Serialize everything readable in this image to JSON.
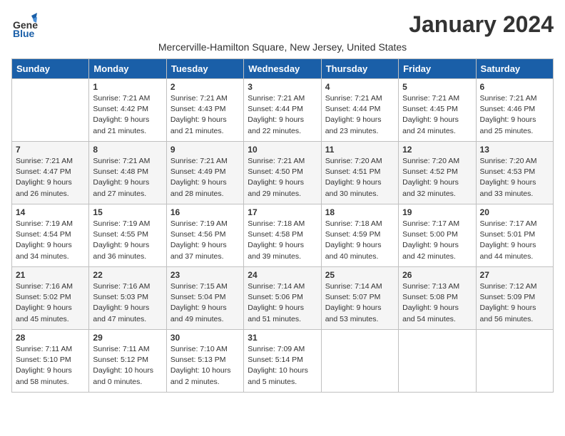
{
  "header": {
    "logo_general": "General",
    "logo_blue": "Blue",
    "month_title": "January 2024",
    "location": "Mercerville-Hamilton Square, New Jersey, United States"
  },
  "weekdays": [
    "Sunday",
    "Monday",
    "Tuesday",
    "Wednesday",
    "Thursday",
    "Friday",
    "Saturday"
  ],
  "weeks": [
    [
      {
        "day": "",
        "sunrise": "",
        "sunset": "",
        "daylight": ""
      },
      {
        "day": "1",
        "sunrise": "Sunrise: 7:21 AM",
        "sunset": "Sunset: 4:42 PM",
        "daylight": "Daylight: 9 hours and 21 minutes."
      },
      {
        "day": "2",
        "sunrise": "Sunrise: 7:21 AM",
        "sunset": "Sunset: 4:43 PM",
        "daylight": "Daylight: 9 hours and 21 minutes."
      },
      {
        "day": "3",
        "sunrise": "Sunrise: 7:21 AM",
        "sunset": "Sunset: 4:44 PM",
        "daylight": "Daylight: 9 hours and 22 minutes."
      },
      {
        "day": "4",
        "sunrise": "Sunrise: 7:21 AM",
        "sunset": "Sunset: 4:44 PM",
        "daylight": "Daylight: 9 hours and 23 minutes."
      },
      {
        "day": "5",
        "sunrise": "Sunrise: 7:21 AM",
        "sunset": "Sunset: 4:45 PM",
        "daylight": "Daylight: 9 hours and 24 minutes."
      },
      {
        "day": "6",
        "sunrise": "Sunrise: 7:21 AM",
        "sunset": "Sunset: 4:46 PM",
        "daylight": "Daylight: 9 hours and 25 minutes."
      }
    ],
    [
      {
        "day": "7",
        "sunrise": "Sunrise: 7:21 AM",
        "sunset": "Sunset: 4:47 PM",
        "daylight": "Daylight: 9 hours and 26 minutes."
      },
      {
        "day": "8",
        "sunrise": "Sunrise: 7:21 AM",
        "sunset": "Sunset: 4:48 PM",
        "daylight": "Daylight: 9 hours and 27 minutes."
      },
      {
        "day": "9",
        "sunrise": "Sunrise: 7:21 AM",
        "sunset": "Sunset: 4:49 PM",
        "daylight": "Daylight: 9 hours and 28 minutes."
      },
      {
        "day": "10",
        "sunrise": "Sunrise: 7:21 AM",
        "sunset": "Sunset: 4:50 PM",
        "daylight": "Daylight: 9 hours and 29 minutes."
      },
      {
        "day": "11",
        "sunrise": "Sunrise: 7:20 AM",
        "sunset": "Sunset: 4:51 PM",
        "daylight": "Daylight: 9 hours and 30 minutes."
      },
      {
        "day": "12",
        "sunrise": "Sunrise: 7:20 AM",
        "sunset": "Sunset: 4:52 PM",
        "daylight": "Daylight: 9 hours and 32 minutes."
      },
      {
        "day": "13",
        "sunrise": "Sunrise: 7:20 AM",
        "sunset": "Sunset: 4:53 PM",
        "daylight": "Daylight: 9 hours and 33 minutes."
      }
    ],
    [
      {
        "day": "14",
        "sunrise": "Sunrise: 7:19 AM",
        "sunset": "Sunset: 4:54 PM",
        "daylight": "Daylight: 9 hours and 34 minutes."
      },
      {
        "day": "15",
        "sunrise": "Sunrise: 7:19 AM",
        "sunset": "Sunset: 4:55 PM",
        "daylight": "Daylight: 9 hours and 36 minutes."
      },
      {
        "day": "16",
        "sunrise": "Sunrise: 7:19 AM",
        "sunset": "Sunset: 4:56 PM",
        "daylight": "Daylight: 9 hours and 37 minutes."
      },
      {
        "day": "17",
        "sunrise": "Sunrise: 7:18 AM",
        "sunset": "Sunset: 4:58 PM",
        "daylight": "Daylight: 9 hours and 39 minutes."
      },
      {
        "day": "18",
        "sunrise": "Sunrise: 7:18 AM",
        "sunset": "Sunset: 4:59 PM",
        "daylight": "Daylight: 9 hours and 40 minutes."
      },
      {
        "day": "19",
        "sunrise": "Sunrise: 7:17 AM",
        "sunset": "Sunset: 5:00 PM",
        "daylight": "Daylight: 9 hours and 42 minutes."
      },
      {
        "day": "20",
        "sunrise": "Sunrise: 7:17 AM",
        "sunset": "Sunset: 5:01 PM",
        "daylight": "Daylight: 9 hours and 44 minutes."
      }
    ],
    [
      {
        "day": "21",
        "sunrise": "Sunrise: 7:16 AM",
        "sunset": "Sunset: 5:02 PM",
        "daylight": "Daylight: 9 hours and 45 minutes."
      },
      {
        "day": "22",
        "sunrise": "Sunrise: 7:16 AM",
        "sunset": "Sunset: 5:03 PM",
        "daylight": "Daylight: 9 hours and 47 minutes."
      },
      {
        "day": "23",
        "sunrise": "Sunrise: 7:15 AM",
        "sunset": "Sunset: 5:04 PM",
        "daylight": "Daylight: 9 hours and 49 minutes."
      },
      {
        "day": "24",
        "sunrise": "Sunrise: 7:14 AM",
        "sunset": "Sunset: 5:06 PM",
        "daylight": "Daylight: 9 hours and 51 minutes."
      },
      {
        "day": "25",
        "sunrise": "Sunrise: 7:14 AM",
        "sunset": "Sunset: 5:07 PM",
        "daylight": "Daylight: 9 hours and 53 minutes."
      },
      {
        "day": "26",
        "sunrise": "Sunrise: 7:13 AM",
        "sunset": "Sunset: 5:08 PM",
        "daylight": "Daylight: 9 hours and 54 minutes."
      },
      {
        "day": "27",
        "sunrise": "Sunrise: 7:12 AM",
        "sunset": "Sunset: 5:09 PM",
        "daylight": "Daylight: 9 hours and 56 minutes."
      }
    ],
    [
      {
        "day": "28",
        "sunrise": "Sunrise: 7:11 AM",
        "sunset": "Sunset: 5:10 PM",
        "daylight": "Daylight: 9 hours and 58 minutes."
      },
      {
        "day": "29",
        "sunrise": "Sunrise: 7:11 AM",
        "sunset": "Sunset: 5:12 PM",
        "daylight": "Daylight: 10 hours and 0 minutes."
      },
      {
        "day": "30",
        "sunrise": "Sunrise: 7:10 AM",
        "sunset": "Sunset: 5:13 PM",
        "daylight": "Daylight: 10 hours and 2 minutes."
      },
      {
        "day": "31",
        "sunrise": "Sunrise: 7:09 AM",
        "sunset": "Sunset: 5:14 PM",
        "daylight": "Daylight: 10 hours and 5 minutes."
      },
      {
        "day": "",
        "sunrise": "",
        "sunset": "",
        "daylight": ""
      },
      {
        "day": "",
        "sunrise": "",
        "sunset": "",
        "daylight": ""
      },
      {
        "day": "",
        "sunrise": "",
        "sunset": "",
        "daylight": ""
      }
    ]
  ]
}
